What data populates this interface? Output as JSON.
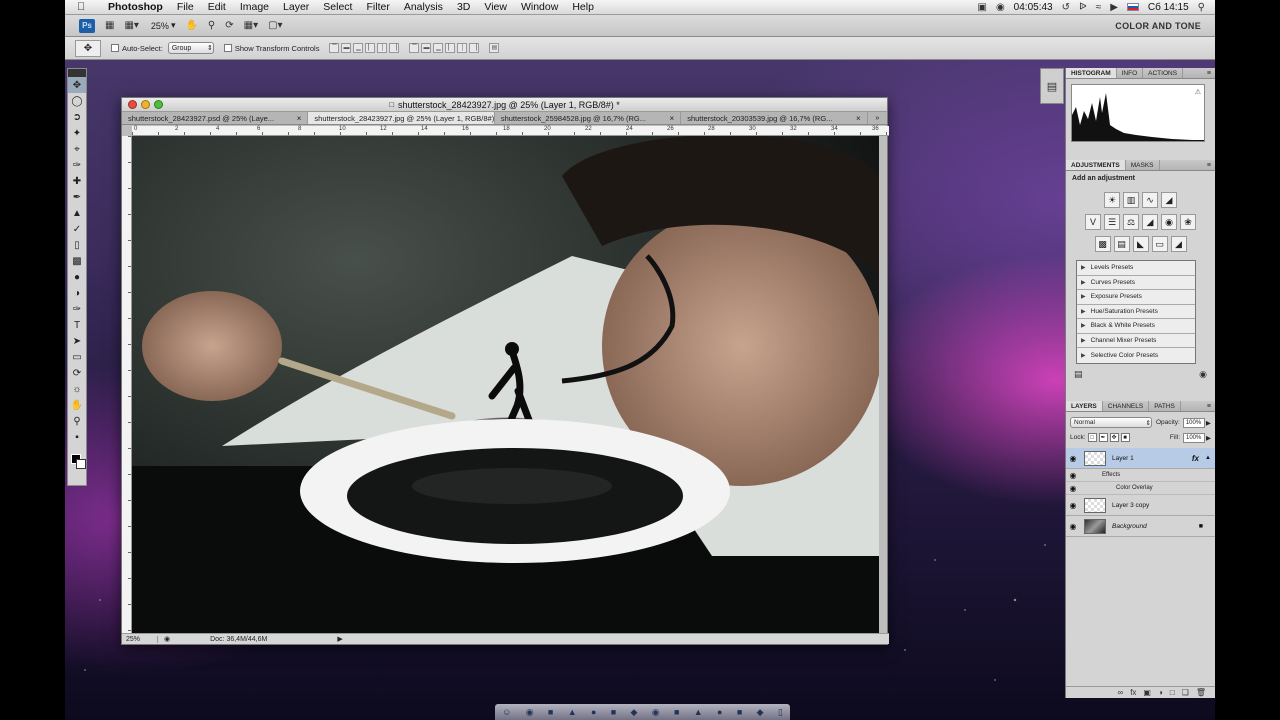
{
  "menubar": {
    "app": "Photoshop",
    "items": [
      "File",
      "Edit",
      "Image",
      "Layer",
      "Select",
      "Filter",
      "Analysis",
      "3D",
      "View",
      "Window",
      "Help"
    ],
    "timer": "04:05:43",
    "clock": "Сб 14:15"
  },
  "appbar": {
    "logo": "Ps",
    "zoom": "25%",
    "workspace": "COLOR AND TONE"
  },
  "options": {
    "auto_select_label": "Auto-Select:",
    "auto_select_value": "Group",
    "show_transform_label": "Show Transform Controls"
  },
  "document": {
    "title": "shutterstock_28423927.jpg @ 25% (Layer 1, RGB/8#) *",
    "tabs": [
      {
        "label": "shutterstock_28423927.psd @ 25% (Laye...",
        "active": false
      },
      {
        "label": "shutterstock_28423927.jpg @ 25% (Layer 1, RGB/8#) *",
        "active": true
      },
      {
        "label": "shutterstock_25984528.jpg @ 16,7% (RG...",
        "active": false
      },
      {
        "label": "shutterstock_20303539.jpg @ 16,7% (RG...",
        "active": false
      }
    ],
    "more_tabs": "»",
    "ruler_numbers": [
      "0",
      "2",
      "4",
      "6",
      "8",
      "10",
      "12",
      "14",
      "16",
      "18",
      "20",
      "22",
      "24",
      "26",
      "28",
      "30",
      "32",
      "34",
      "36"
    ],
    "status_zoom": "25%",
    "status_info": "Doc: 36,4M/44,6M"
  },
  "histogram_panel": {
    "tabs": [
      "HISTOGRAM",
      "INFO",
      "ACTIONS"
    ]
  },
  "adjustments_panel": {
    "tabs": [
      "ADJUSTMENTS",
      "MASKS"
    ],
    "heading": "Add an adjustment",
    "presets": [
      "Levels Presets",
      "Curves Presets",
      "Exposure Presets",
      "Hue/Saturation Presets",
      "Black & White Presets",
      "Channel Mixer Presets",
      "Selective Color Presets"
    ]
  },
  "layers_panel": {
    "tabs": [
      "LAYERS",
      "CHANNELS",
      "PATHS"
    ],
    "blend_mode": "Normal",
    "opacity_label": "Opacity:",
    "opacity": "100%",
    "lock_label": "Lock:",
    "fill_label": "Fill:",
    "fill": "100%",
    "layers": [
      {
        "name": "Layer 1",
        "fx": "fx",
        "effects_label": "Effects",
        "effect": "Color Overlay"
      },
      {
        "name": "Layer 3 copy"
      },
      {
        "name": "Background"
      }
    ]
  },
  "colors": {
    "menubar": "#e6e6e6",
    "panel_bg": "#d4d4d4",
    "active_layer": "#b8cbe6",
    "wallpaper_pink": "#e046c8"
  }
}
